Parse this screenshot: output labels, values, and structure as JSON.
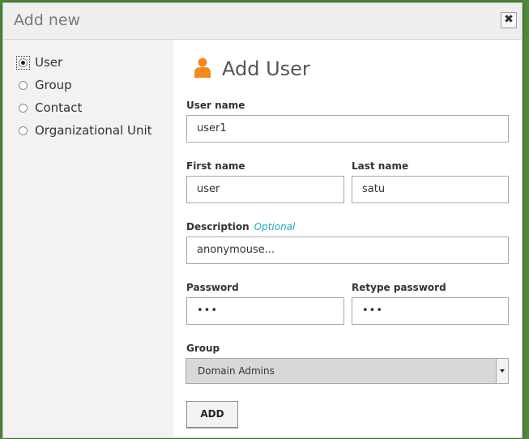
{
  "dialog": {
    "title": "Add new",
    "close_label": "✖"
  },
  "sidebar": {
    "items": [
      {
        "label": "User",
        "checked": true
      },
      {
        "label": "Group",
        "checked": false
      },
      {
        "label": "Contact",
        "checked": false
      },
      {
        "label": "Organizational Unit",
        "checked": false
      }
    ]
  },
  "form": {
    "heading": "Add User",
    "heading_icon": "user-icon",
    "username": {
      "label": "User name",
      "value": "user1"
    },
    "first_name": {
      "label": "First name",
      "value": "user"
    },
    "last_name": {
      "label": "Last name",
      "value": "satu"
    },
    "description": {
      "label": "Description",
      "optional": "Optional",
      "value": "anonymouse..."
    },
    "password": {
      "label": "Password",
      "value": "•••"
    },
    "retype_password": {
      "label": "Retype password",
      "value": "•••"
    },
    "group": {
      "label": "Group",
      "value": "Domain Admins"
    },
    "submit_label": "ADD"
  },
  "colors": {
    "accent_orange": "#f28a1e",
    "optional_text": "#2aa6bf",
    "background_green": "#4f8a3a"
  }
}
